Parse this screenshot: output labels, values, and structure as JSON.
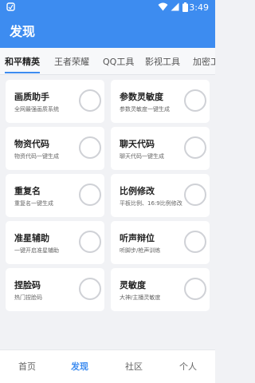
{
  "status_bar": {
    "time": "3:49",
    "icons": [
      "notification-icon",
      "wifi-icon",
      "signal-icon",
      "battery-icon"
    ]
  },
  "app_bar": {
    "title": "发现"
  },
  "tabs": [
    {
      "label": "和平精英",
      "active": true
    },
    {
      "label": "王者荣耀",
      "active": false
    },
    {
      "label": "QQ工具",
      "active": false
    },
    {
      "label": "影视工具",
      "active": false
    },
    {
      "label": "加密工",
      "active": false
    }
  ],
  "cards": [
    {
      "title": "画质助手",
      "subtitle": "全网最强画质系统",
      "enabled": false
    },
    {
      "title": "参数灵敏度",
      "subtitle": "参数灵敏度一键生成",
      "enabled": false
    },
    {
      "title": "物资代码",
      "subtitle": "物资代码一键生成",
      "enabled": false
    },
    {
      "title": "聊天代码",
      "subtitle": "聊天代码一键生成",
      "enabled": false
    },
    {
      "title": "重复名",
      "subtitle": "重复名一键生成",
      "enabled": false
    },
    {
      "title": "比例修改",
      "subtitle": "平板比例、16:9比例修改",
      "enabled": false
    },
    {
      "title": "准星辅助",
      "subtitle": "一键开启准星辅助",
      "enabled": false
    },
    {
      "title": "听声辩位",
      "subtitle": "听脚步/枪声训练",
      "enabled": false
    },
    {
      "title": "捏脸码",
      "subtitle": "热门捏脸码",
      "enabled": false
    },
    {
      "title": "灵敏度",
      "subtitle": "大神/主播灵敏度",
      "enabled": false
    }
  ],
  "bottom_nav": [
    {
      "label": "首页",
      "active": false
    },
    {
      "label": "发现",
      "active": true
    },
    {
      "label": "社区",
      "active": false
    },
    {
      "label": "个人",
      "active": false
    }
  ],
  "colors": {
    "primary": "#3d8cf0",
    "background": "#f1f2f5",
    "card": "#ffffff",
    "toggle_border": "#cfd1d6"
  }
}
